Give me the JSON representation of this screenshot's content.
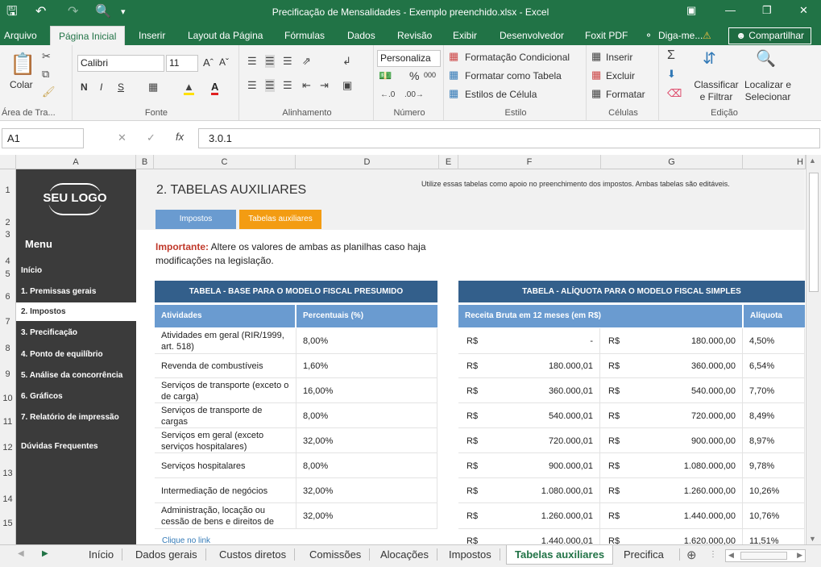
{
  "window": {
    "title": "Precificação de Mensalidades - Exemplo preenchido.xlsx - Excel"
  },
  "ribbon_tabs": [
    "Arquivo",
    "Página Inicial",
    "Inserir",
    "Layout da Página",
    "Fórmulas",
    "Dados",
    "Revisão",
    "Exibir",
    "Desenvolvedor",
    "Foxit PDF"
  ],
  "tell_me": "Diga-me...",
  "share": "Compartilhar",
  "ribbon": {
    "paste": "Colar",
    "clipboard": "Área de Tra...",
    "font_group": "Fonte",
    "font_name": "Calibri",
    "font_size": "11",
    "bold": "N",
    "italic": "I",
    "underline": "S",
    "align_group": "Alinhamento",
    "number_format": "Personaliza",
    "number_group": "Número",
    "cond_format": "Formatação Condicional",
    "format_table": "Formatar como Tabela",
    "cell_styles": "Estilos de Célula",
    "styles_group": "Estilo",
    "insert": "Inserir",
    "delete": "Excluir",
    "format": "Formatar",
    "cells_group": "Células",
    "sort": "Classificar e Filtrar",
    "find": "Localizar e Selecionar",
    "edit_group": "Edição"
  },
  "formula_bar": {
    "name_box": "A1",
    "content": "3.0.1"
  },
  "columns": [
    "A",
    "B",
    "C",
    "D",
    "E",
    "F",
    "G",
    "H"
  ],
  "rows": [
    "1",
    "2",
    "3",
    "4",
    "5",
    "6",
    "7",
    "8",
    "9",
    "10",
    "11",
    "12",
    "13",
    "14",
    "15"
  ],
  "sidebar": {
    "logo": "SEU LOGO",
    "menu_title": "Menu",
    "items": [
      "Início",
      "1. Premissas gerais",
      "2. Impostos",
      "3. Precificação",
      "4. Ponto de equilíbrio",
      "5. Análise da concorrência",
      "6. Gráficos",
      "7. Relatório de impressão",
      "Dúvidas Frequentes"
    ]
  },
  "page": {
    "title": "2. TABELAS AUXILIARES",
    "subtitle": "Utilize essas tabelas como apoio no preenchimento dos impostos. Ambas tabelas são editáveis.",
    "tab1": "Impostos",
    "tab2": "Tabelas auxiliares",
    "note_bold": "Importante:",
    "note_text": "Altere os valores de ambas as planilhas caso haja modificações na legislação.",
    "link": "Clique no link"
  },
  "table1": {
    "title": "TABELA - BASE PARA O MODELO FISCAL PRESUMIDO",
    "headers": [
      "Atividades",
      "Percentuais (%)"
    ],
    "rows": [
      [
        "Atividades em geral (RIR/1999, art. 518)",
        "8,00%"
      ],
      [
        "Revenda de combustíveis",
        "1,60%"
      ],
      [
        "Serviços de transporte (exceto o de carga)",
        "16,00%"
      ],
      [
        "Serviços de transporte de cargas",
        "8,00%"
      ],
      [
        "Serviços em geral (exceto serviços hospitalares)",
        "32,00%"
      ],
      [
        "Serviços hospitalares",
        "8,00%"
      ],
      [
        "Intermediação de negócios",
        "32,00%"
      ],
      [
        "Administração, locação ou cessão de bens e direitos de",
        "32,00%"
      ]
    ]
  },
  "table2": {
    "title": "TABELA - ALÍQUOTA PARA O MODELO FISCAL SIMPLES",
    "headers": [
      "Receita Bruta em 12 meses (em R$)",
      "Alíquota"
    ],
    "currency": "R$",
    "rows": [
      [
        "-",
        "180.000,00",
        "4,50%"
      ],
      [
        "180.000,01",
        "360.000,00",
        "6,54%"
      ],
      [
        "360.000,01",
        "540.000,00",
        "7,70%"
      ],
      [
        "540.000,01",
        "720.000,00",
        "8,49%"
      ],
      [
        "720.000,01",
        "900.000,00",
        "8,97%"
      ],
      [
        "900.000,01",
        "1.080.000,00",
        "9,78%"
      ],
      [
        "1.080.000,01",
        "1.260.000,00",
        "10,26%"
      ],
      [
        "1.260.000,01",
        "1.440.000,00",
        "10,76%"
      ],
      [
        "1.440.000,01",
        "1.620.000,00",
        "11,51%"
      ]
    ]
  },
  "sheet_tabs": [
    "Início",
    "Dados gerais",
    "Custos diretos",
    "Comissões",
    "Alocações",
    "Impostos",
    "Tabelas auxiliares",
    "Precifica"
  ],
  "active_sheet": "Tabelas auxiliares"
}
